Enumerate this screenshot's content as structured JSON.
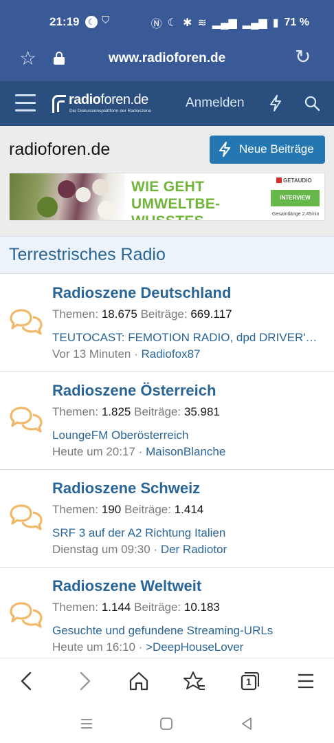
{
  "status_bar": {
    "time": "21:19",
    "battery": "71 %"
  },
  "url_bar": {
    "url": "www.radioforen.de"
  },
  "site_header": {
    "logo_prefix": "radio",
    "logo_suffix": "foren.de",
    "tagline": "Die Diskussionsplattform der Radioszene",
    "login_label": "Anmelden"
  },
  "page": {
    "title": "radioforen.de",
    "new_posts_label": "Neue Beiträge"
  },
  "ad": {
    "headline_line1": "WIE GEHT UMWELTBE-",
    "headline_line2": "WUSSTES EINKAUFEN?",
    "brand": "GETAUDIO",
    "cta": "INTERVIEW",
    "duration": "Gesamtlänge 2.45min"
  },
  "section": {
    "title": "Terrestrisches Radio"
  },
  "labels": {
    "themen": "Themen:",
    "beitraege": "Beiträge:"
  },
  "forums": [
    {
      "name": "Radioszene Deutschland",
      "themen": "18.675",
      "beitraege": "669.117",
      "last_thread": "TEUTOCAST: FEMOTION RADIO, dpd DRIVER'S R...",
      "last_time": "Vor 13 Minuten",
      "last_user": "Radiofox87"
    },
    {
      "name": "Radioszene Österreich",
      "themen": "1.825",
      "beitraege": "35.981",
      "last_thread": "LoungeFM Oberösterreich",
      "last_time": "Heute um 20:17",
      "last_user": "MaisonBlanche"
    },
    {
      "name": "Radioszene Schweiz",
      "themen": "190",
      "beitraege": "1.414",
      "last_thread": "SRF 3 auf der A2 Richtung Italien",
      "last_time": "Dienstag um 09:30",
      "last_user": "Der Radiotor"
    },
    {
      "name": "Radioszene Weltweit",
      "themen": "1.144",
      "beitraege": "10.183",
      "last_thread": "Gesuchte und gefundene Streaming-URLs",
      "last_time": "Heute um 16:10",
      "last_user": ">DeepHouseLover"
    }
  ],
  "toolbar": {
    "tab_count": "1"
  },
  "colors": {
    "browser_bar": "#3a5997",
    "site_header": "#2a4f7e",
    "link_blue": "#2a6597",
    "button_blue": "#2577b1",
    "forum_icon": "#f2b86a"
  }
}
